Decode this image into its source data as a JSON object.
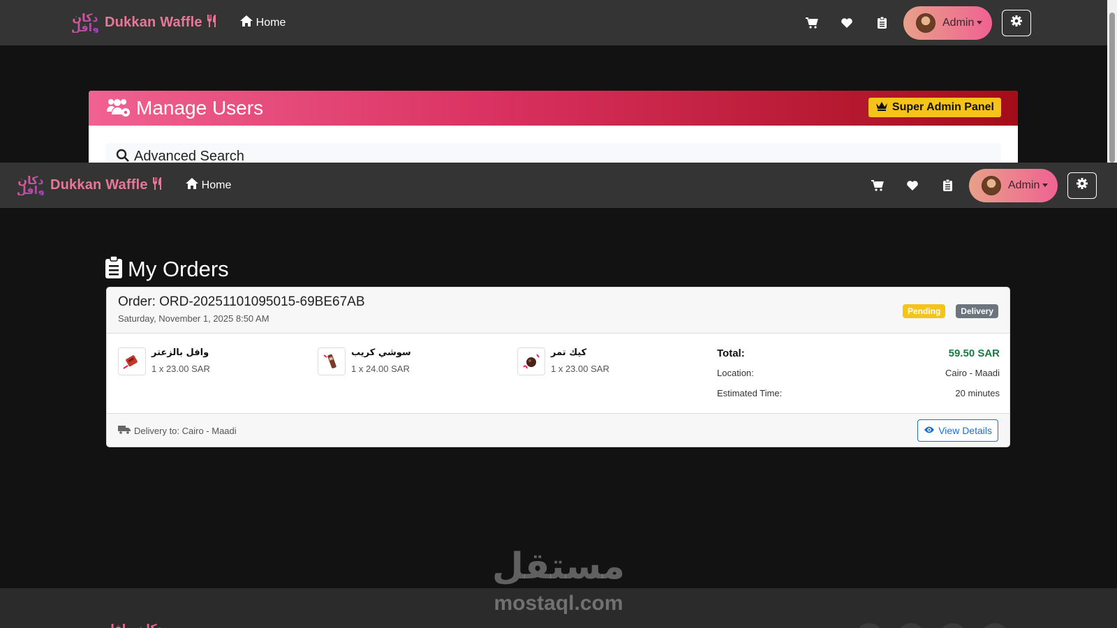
{
  "navbar": {
    "logo_text": "دكان وافل",
    "brand_name": "Dukkan Waffle",
    "home_label": "Home",
    "admin_label": "Admin",
    "icons": [
      "cart-icon",
      "heart-icon",
      "clipboard-icon",
      "gear-icon"
    ]
  },
  "manage_users": {
    "title": "Manage Users",
    "badge": "Super Admin Panel",
    "advanced_search_label": "Advanced Search"
  },
  "my_orders": {
    "title": "My Orders",
    "order": {
      "id_label": "Order: ORD-20251101095015-69BE67AB",
      "date": "Saturday, November 1, 2025 8:50 AM",
      "status_badge": "Pending",
      "type_badge": "Delivery",
      "items": [
        {
          "name": "وافل بالزعتر",
          "qty": "1 x 23.00 SAR"
        },
        {
          "name": "سوشي كريب",
          "qty": "1 x 24.00 SAR"
        },
        {
          "name": "كيك تمر",
          "qty": "1 x 23.00 SAR"
        }
      ],
      "summary": {
        "total_label": "Total:",
        "total_value": "59.50 SAR",
        "location_label": "Location:",
        "location_value": "Cairo - Maadi",
        "eta_label": "Estimated Time:",
        "eta_value": "20 minutes"
      },
      "delivery_to": "Delivery to: Cairo - Maadi",
      "view_details": "View Details"
    }
  },
  "watermark": {
    "arabic": "مستقل",
    "english": "mostaql.com"
  },
  "colors": {
    "brand_pink": "#e8789a",
    "header_gradient_start": "#f06292",
    "header_gradient_end": "#a30d18",
    "badge_yellow": "#f5c31a",
    "total_green": "#1a7a45",
    "link_blue": "#1a6fd6"
  }
}
